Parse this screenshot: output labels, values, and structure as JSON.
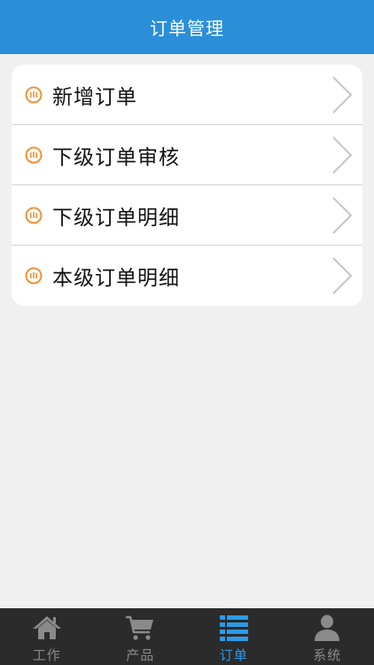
{
  "header": {
    "title": "订单管理"
  },
  "menu": {
    "items": [
      {
        "label": "新增订单"
      },
      {
        "label": "下级订单审核"
      },
      {
        "label": "下级订单明细"
      },
      {
        "label": "本级订单明细"
      }
    ]
  },
  "tabbar": {
    "tabs": [
      {
        "label": "工作",
        "icon": "home-icon"
      },
      {
        "label": "产品",
        "icon": "cart-icon"
      },
      {
        "label": "订单",
        "icon": "list-icon"
      },
      {
        "label": "系统",
        "icon": "user-icon"
      }
    ],
    "active_index": 2
  },
  "colors": {
    "header_bg": "#2a8fd9",
    "accent_orange": "#f0913a",
    "tab_active": "#2a9be8",
    "tab_inactive": "#8a8a8a",
    "tabbar_bg": "#2b2b2b"
  }
}
